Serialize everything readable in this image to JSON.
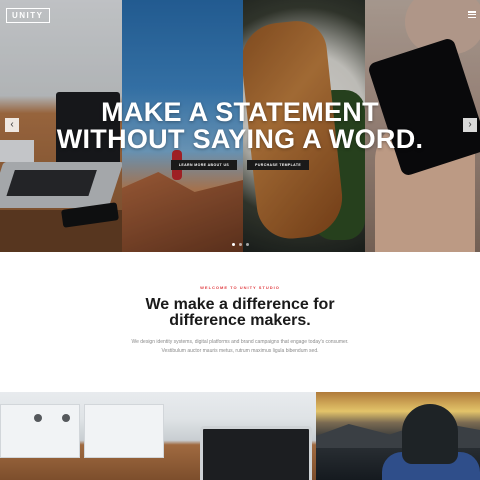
{
  "brand": {
    "logo_text": "UNITY"
  },
  "hero": {
    "headline_line1": "MAKE A STATEMENT",
    "headline_line2": "WITHOUT SAYING A WORD.",
    "primary_button": "LEARN MORE ABOUT US",
    "secondary_button": "PURCHASE TEMPLATE",
    "prev_arrow": "‹",
    "next_arrow": "›",
    "active_slide": 1,
    "slide_count": 3
  },
  "intro": {
    "eyebrow": "WELCOME TO UNITY STUDIO",
    "title_line1": "We make a difference for",
    "title_line2": "difference makers.",
    "desc_line1": "We design identity systems, digital platforms and brand campaigns that engage today's consumer.",
    "desc_line2": "Vestibulum auctor mauris metus, rutrum maximus ligula bibendum sed."
  },
  "colors": {
    "accent": "#e0393e",
    "button_bg": "#1a1a1a",
    "title": "#1a1a1a",
    "body_text": "#8a8a8a"
  },
  "icons": {
    "menu": "hamburger-menu-icon",
    "prev": "chevron-left-icon",
    "next": "chevron-right-icon"
  }
}
